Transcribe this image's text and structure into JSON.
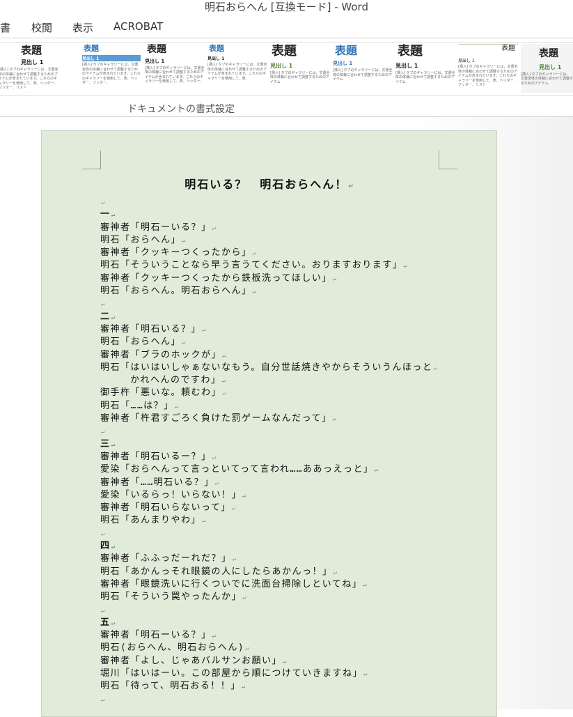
{
  "window": {
    "title": "明石おらへん [互換モード] - Word"
  },
  "menu": {
    "items": [
      "書",
      "校閲",
      "表示",
      "ACROBAT"
    ]
  },
  "styles_gallery": {
    "thumbnails": [
      {
        "title": "表題",
        "heading": "見出し 1",
        "body": "[挿入] タブのギャラリーには、文書全体の体裁に合わせて調整するためのアイテムが含まれています。これらのギャラリーを使用して、表、ヘッダー、フッター、リスト"
      },
      {
        "title": "表題",
        "heading": "見出し 1",
        "body": "[挿入] タブのギャラリーには、文書全体の体裁に合わせて調整するためのアイテムが含まれています。これらのギャラリーを使用して、表、ヘッダー、フッター、"
      },
      {
        "title": "表題",
        "heading": "見出し 1",
        "body": "[挿入] タブのギャラリーには、文書全体の体裁に合わせて調整するためのアイテムが含まれています。これらのギャラリーを使用して、表、ヘッダー、"
      },
      {
        "title": "表題",
        "heading": "見出し 1",
        "body": "[挿入] タブのギャラリーには、文書全体の体裁に合わせて調整するためのアイテムが含まれています。これらのギャラリーを使用して、表、"
      },
      {
        "title": "表題",
        "heading": "見出し 1",
        "body": "[挿入] タブのギャラリーには、文書全体の体裁に合わせて調整するためのアイテム"
      },
      {
        "title": "表題",
        "heading": "見出し 1",
        "body": "[挿入] タブのギャラリーには、文書全体の体裁に合わせて調整するためのアイテム"
      },
      {
        "title": "表題",
        "heading": "見出し 1",
        "body": "[挿入] タブのギャラリーには、文書全体の体裁に合わせて調整するためのアイテム"
      },
      {
        "title": "表題",
        "heading": "見出し 1",
        "body": "[挿入] タブのギャラリーには、文書全体の体裁に合わせて調整するためのアイテムが含まれています。これらのギャラリーを使用して、表、ヘッダー、フッター、リスト"
      },
      {
        "title": "表題",
        "heading": "見出し 1",
        "body": "[挿入] タブのギャラリーには、文書全体の体裁に合わせて調整するためのアイテム"
      }
    ],
    "group_label": "ドキュメントの書式設定",
    "colors": {
      "blue": "#2e74b5",
      "green": "#548235",
      "selected": "#5b9bd5"
    }
  },
  "document": {
    "title": "明石いる？　明石おらへん！",
    "paragraph_mark": "↵",
    "lines": [
      "",
      "一",
      "審神者「明石ーいる？」",
      "明石「おらへん」",
      "審神者「クッキーつくったから」",
      "明石「そういうことなら早う言うてください。おりますおります」",
      "審神者「クッキーつくったから鉄板洗ってほしい」",
      "明石「おらへん。明石おらへん」",
      "",
      "二",
      "審神者「明石いる？」",
      "明石「おらへん」",
      "審神者「ブラのホックが」",
      "明石「はいはいしゃぁないなもう。自分世話焼きやからそういうんほっと",
      "かれへんのですわ」",
      "御手杵「悪いな。頼むわ」",
      "明石「……は？」",
      "審神者「杵君すごろく負けた罰ゲームなんだって」",
      "",
      "三",
      "審神者「明石いるー？」",
      "愛染「おらへんって言っといてって言われ……ああっえっと」",
      "審神者「……明石いる？」",
      "愛染「いるらっ！いらない！」",
      "審神者「明石いらないって」",
      "明石「あんまりやわ」",
      "",
      "四",
      "審神者「ふふっだーれだ？」",
      "明石「あかんっそれ眼鏡の人にしたらあかんっ！」",
      "審神者「眼鏡洗いに行くついでに洗面台掃除しといてね」",
      "明石「そういう罠やったんか」",
      "",
      "五",
      "審神者「明石ーいる？」",
      "明石(おらへん、明石おらへん)",
      "審神者「よし、じゃあバルサンお願い」",
      "堀川「はいはーい。この部屋から順につけていきますね」",
      "明石「待って、明石おる！！」",
      ""
    ],
    "background_color": "#e0ecd9"
  }
}
